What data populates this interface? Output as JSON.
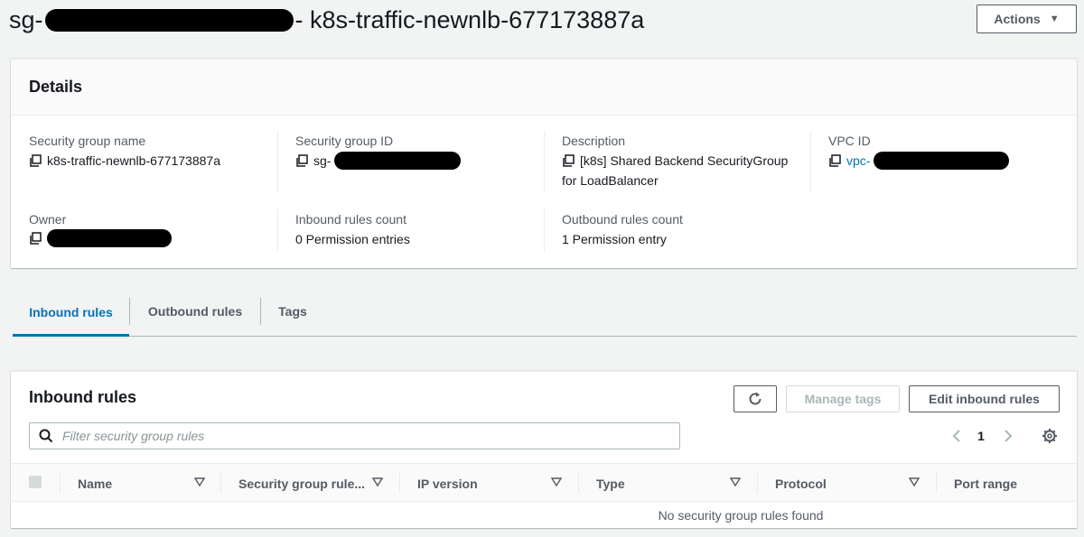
{
  "header": {
    "title_prefix": "sg-",
    "title_suffix": "- k8s-traffic-newnlb-677173887a",
    "actions_label": "Actions"
  },
  "details": {
    "title": "Details",
    "sg_name_label": "Security group name",
    "sg_name_value": "k8s-traffic-newnlb-677173887a",
    "sg_id_label": "Security group ID",
    "sg_id_prefix": "sg-",
    "description_label": "Description",
    "description_value_line1": "[k8s] Shared Backend SecurityGroup",
    "description_value_line2": "for LoadBalancer",
    "vpc_id_label": "VPC ID",
    "vpc_id_prefix": "vpc-",
    "owner_label": "Owner",
    "inbound_count_label": "Inbound rules count",
    "inbound_count_value": "0 Permission entries",
    "outbound_count_label": "Outbound rules count",
    "outbound_count_value": "1 Permission entry"
  },
  "tabs": [
    {
      "label": "Inbound rules",
      "active": true
    },
    {
      "label": "Outbound rules",
      "active": false
    },
    {
      "label": "Tags",
      "active": false
    }
  ],
  "inbound_rules": {
    "title": "Inbound rules",
    "refresh_icon": "refresh-icon",
    "manage_tags_label": "Manage tags",
    "edit_label": "Edit inbound rules",
    "search_placeholder": "Filter security group rules",
    "page_number": "1",
    "columns": [
      "Name",
      "Security group rule...",
      "IP version",
      "Type",
      "Protocol",
      "Port range"
    ],
    "empty_message": "No security group rules found"
  },
  "colors": {
    "link": "#0073bb",
    "redaction": "#000000",
    "background": "#f2f3f3"
  }
}
